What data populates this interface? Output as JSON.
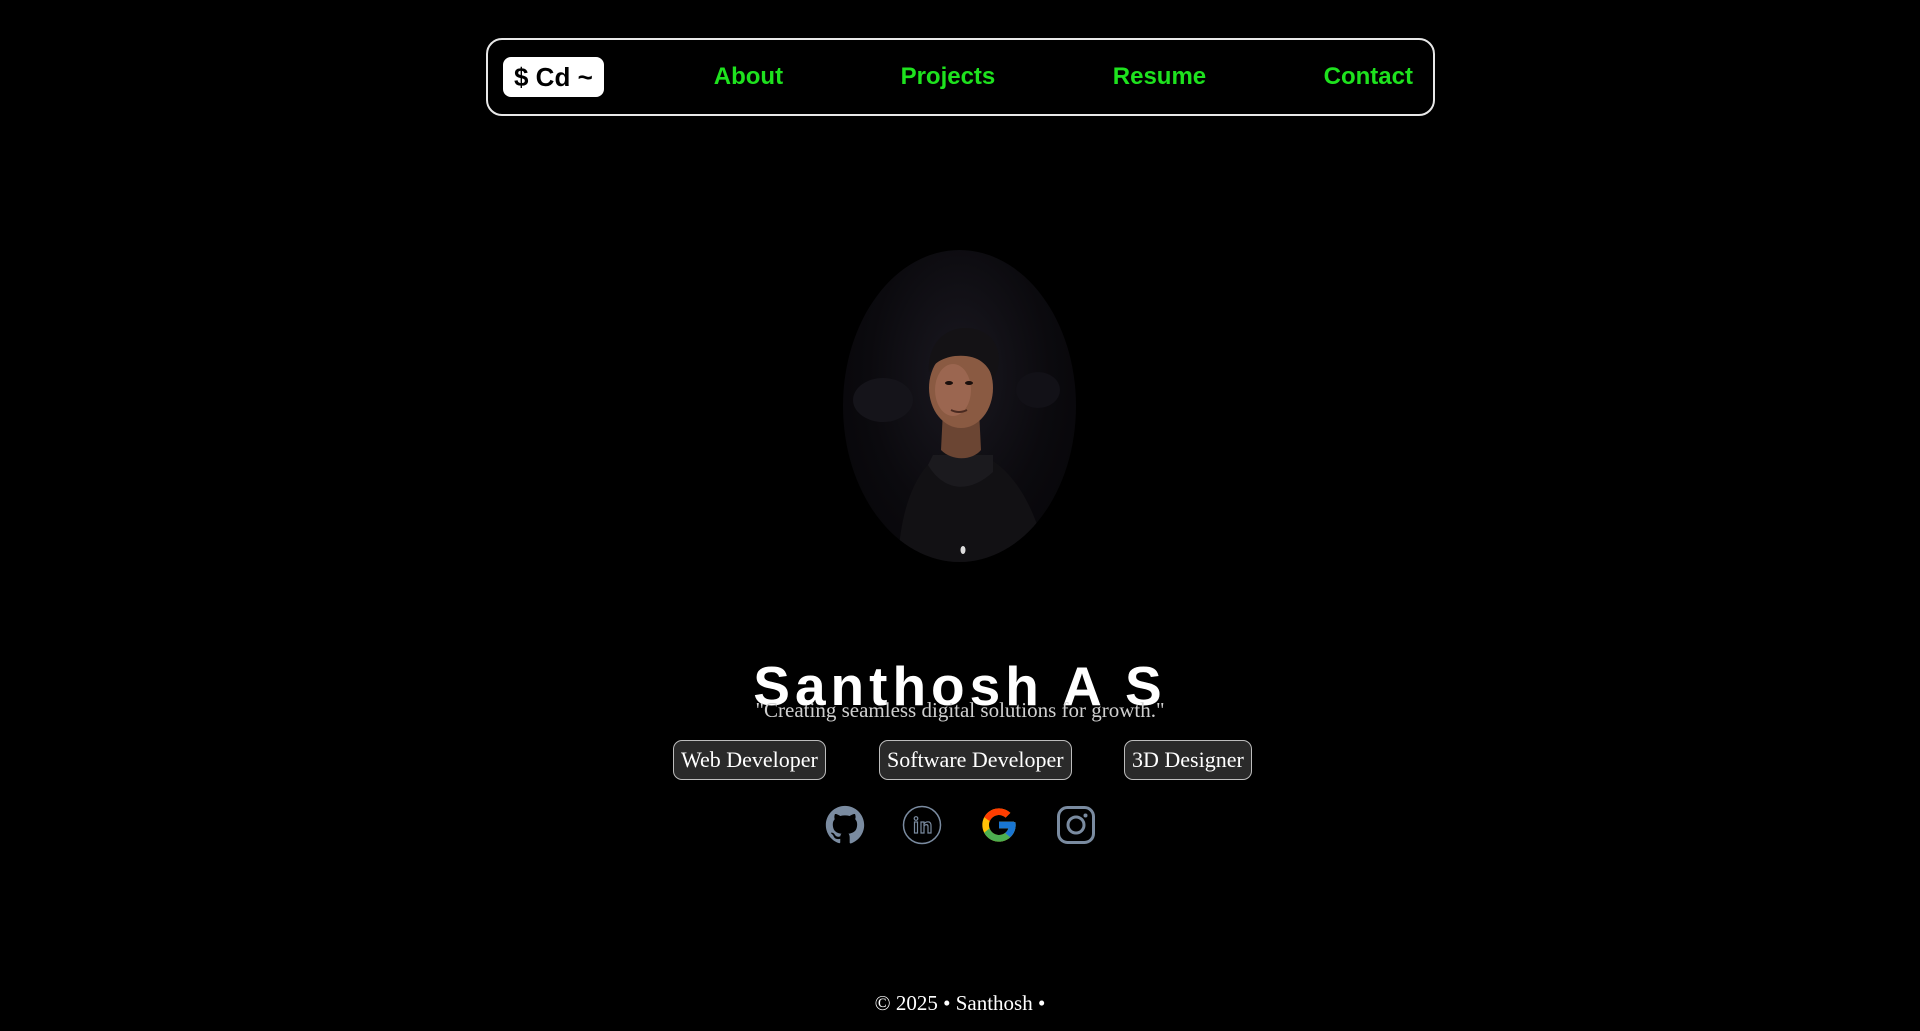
{
  "nav": {
    "logo_text": "$ Cd ~",
    "links": [
      "About",
      "Projects",
      "Resume",
      "Contact"
    ],
    "link_color": "#1ee21e"
  },
  "hero": {
    "name": "Santhosh A S",
    "tagline": "\"Creating seamless digital solutions for growth.\"",
    "roles": [
      "Web Developer",
      "Software Developer",
      "3D Designer"
    ]
  },
  "socials": [
    {
      "icon": "github-icon"
    },
    {
      "icon": "linkedin-icon"
    },
    {
      "icon": "google-icon"
    },
    {
      "icon": "instagram-icon"
    }
  ],
  "footer": {
    "text": "© 2025 • Santhosh •"
  },
  "colors": {
    "background": "#000000",
    "accent": "#1ee21e",
    "icon_gray": "#7a8ba0"
  }
}
